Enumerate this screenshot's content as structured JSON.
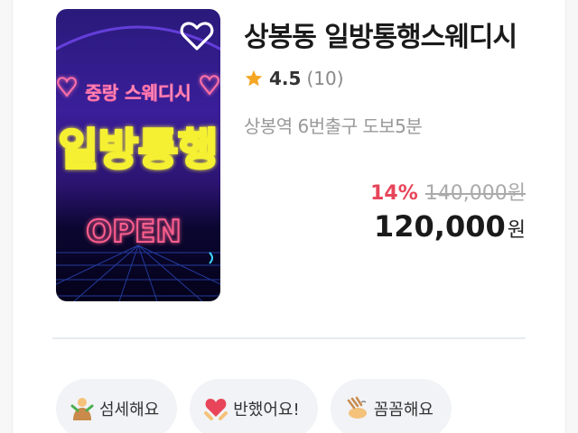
{
  "listing": {
    "title": "상봉동 일방통행스웨디시",
    "rating": "4.5",
    "review_count": "(10)",
    "location": "상봉역 6번출구 도보5분",
    "discount": "14%",
    "original_price": "140,000원",
    "final_price": "120,000",
    "final_unit": "원",
    "favorited": false
  },
  "thumbnail": {
    "line1": "중랑 스웨디시",
    "line2": "일방통행",
    "line3": "OPEN"
  },
  "review_tags": [
    {
      "label": "섬세해요",
      "icon": "care-person-icon"
    },
    {
      "label": "반했어요!",
      "icon": "heart-hug-icon"
    },
    {
      "label": "꼼꼼해요",
      "icon": "massage-hands-icon"
    }
  ],
  "colors": {
    "discount": "#e8455a",
    "star": "#f5a623",
    "neon_yellow": "#f5f032",
    "neon_pink": "#ff6fa8"
  }
}
